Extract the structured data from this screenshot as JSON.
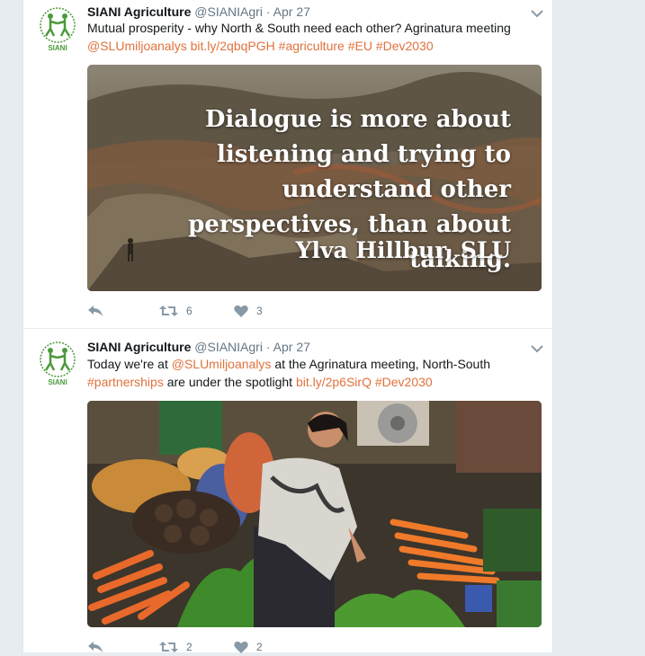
{
  "tweets": [
    {
      "author_name": "SIANI Agriculture",
      "handle": "@SIANIAgri",
      "separator": "·",
      "date": "Apr 27",
      "avatar_label": "SIANI",
      "text_plain_1": "Mutual prosperity - why North & South need each other? Agrinatura meeting",
      "link_1": "@SLUmiljoanalys",
      "link_2": "bit.ly/2qbqPGH",
      "link_3": "#agriculture",
      "link_4": "#EU",
      "link_5": "#Dev2030",
      "media": {
        "quote": "Dialogue is more about listening and trying to understand other perspectives, than about talking.",
        "attribution": "Ylva Hillbur, SLU"
      },
      "retweets": "6",
      "likes": "3"
    },
    {
      "author_name": "SIANI Agriculture",
      "handle": "@SIANIAgri",
      "separator": "·",
      "date": "Apr 27",
      "avatar_label": "SIANI",
      "text_plain_1": "Today we're at",
      "link_1": "@SLUmiljoanalys",
      "text_plain_2": "at the Agrinatura meeting, North-South",
      "link_2": "#partnerships",
      "text_plain_3": "are under the spotlight",
      "link_3": "bit.ly/2p6SirQ",
      "link_4": "#Dev2030",
      "retweets": "2",
      "likes": "2"
    }
  ],
  "colors": {
    "link": "#e0723d",
    "background": "#e6ecf0",
    "icon": "#8899a6",
    "logo_green": "#4a9a3a"
  },
  "icons": {
    "reply": "reply-icon",
    "retweet": "retweet-icon",
    "like": "heart-icon",
    "caret": "chevron-down-icon"
  }
}
